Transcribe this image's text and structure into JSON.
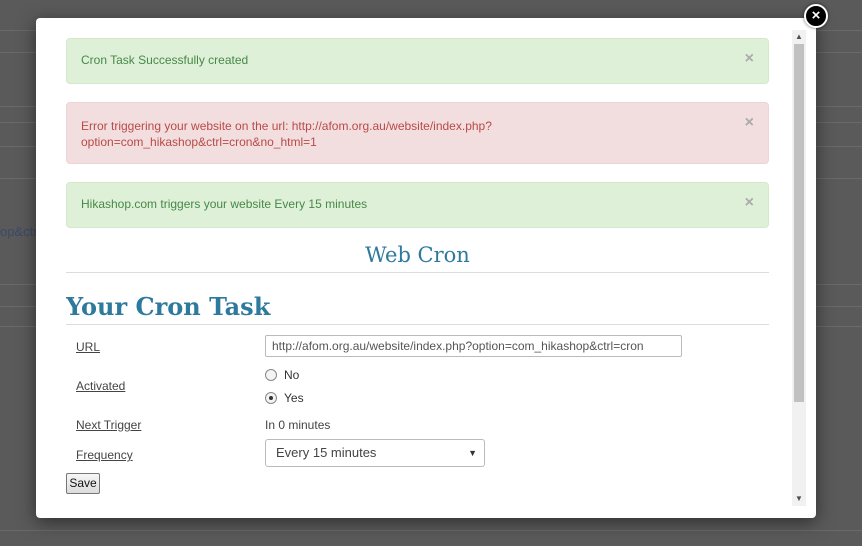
{
  "background": {
    "partial_text": "op&ctr"
  },
  "alerts": [
    {
      "type": "success",
      "message": "Cron Task Successfully created",
      "close": "×"
    },
    {
      "type": "error",
      "message_line1": "Error triggering your website on the url: http://afom.org.au/website/index.php?",
      "message_line2": "option=com_hikashop&ctrl=cron&no_html=1",
      "close": "×"
    },
    {
      "type": "success",
      "message": "Hikashop.com triggers your website Every 15 minutes",
      "close": "×"
    }
  ],
  "web_cron_title": "Web Cron",
  "task_title": "Your Cron Task",
  "form": {
    "url_label": "URL",
    "url_value": "http://afom.org.au/website/index.php?option=com_hikashop&ctrl=cron",
    "activated_label": "Activated",
    "activated_options": [
      {
        "label": "No",
        "checked": false
      },
      {
        "label": "Yes",
        "checked": true
      }
    ],
    "next_trigger_label": "Next Trigger",
    "next_trigger_value": "In 0 minutes",
    "frequency_label": "Frequency",
    "frequency_value": "Every 15 minutes",
    "save_label": "Save"
  },
  "icons": {
    "close_modal": "close-icon",
    "dismiss": "close-icon",
    "dropdown": "chevron-down-icon"
  },
  "colors": {
    "success_bg": "#dff0d8",
    "success_text": "#468847",
    "error_bg": "#f2dede",
    "error_text": "#b94a48",
    "title_color": "#2e7a9c"
  }
}
